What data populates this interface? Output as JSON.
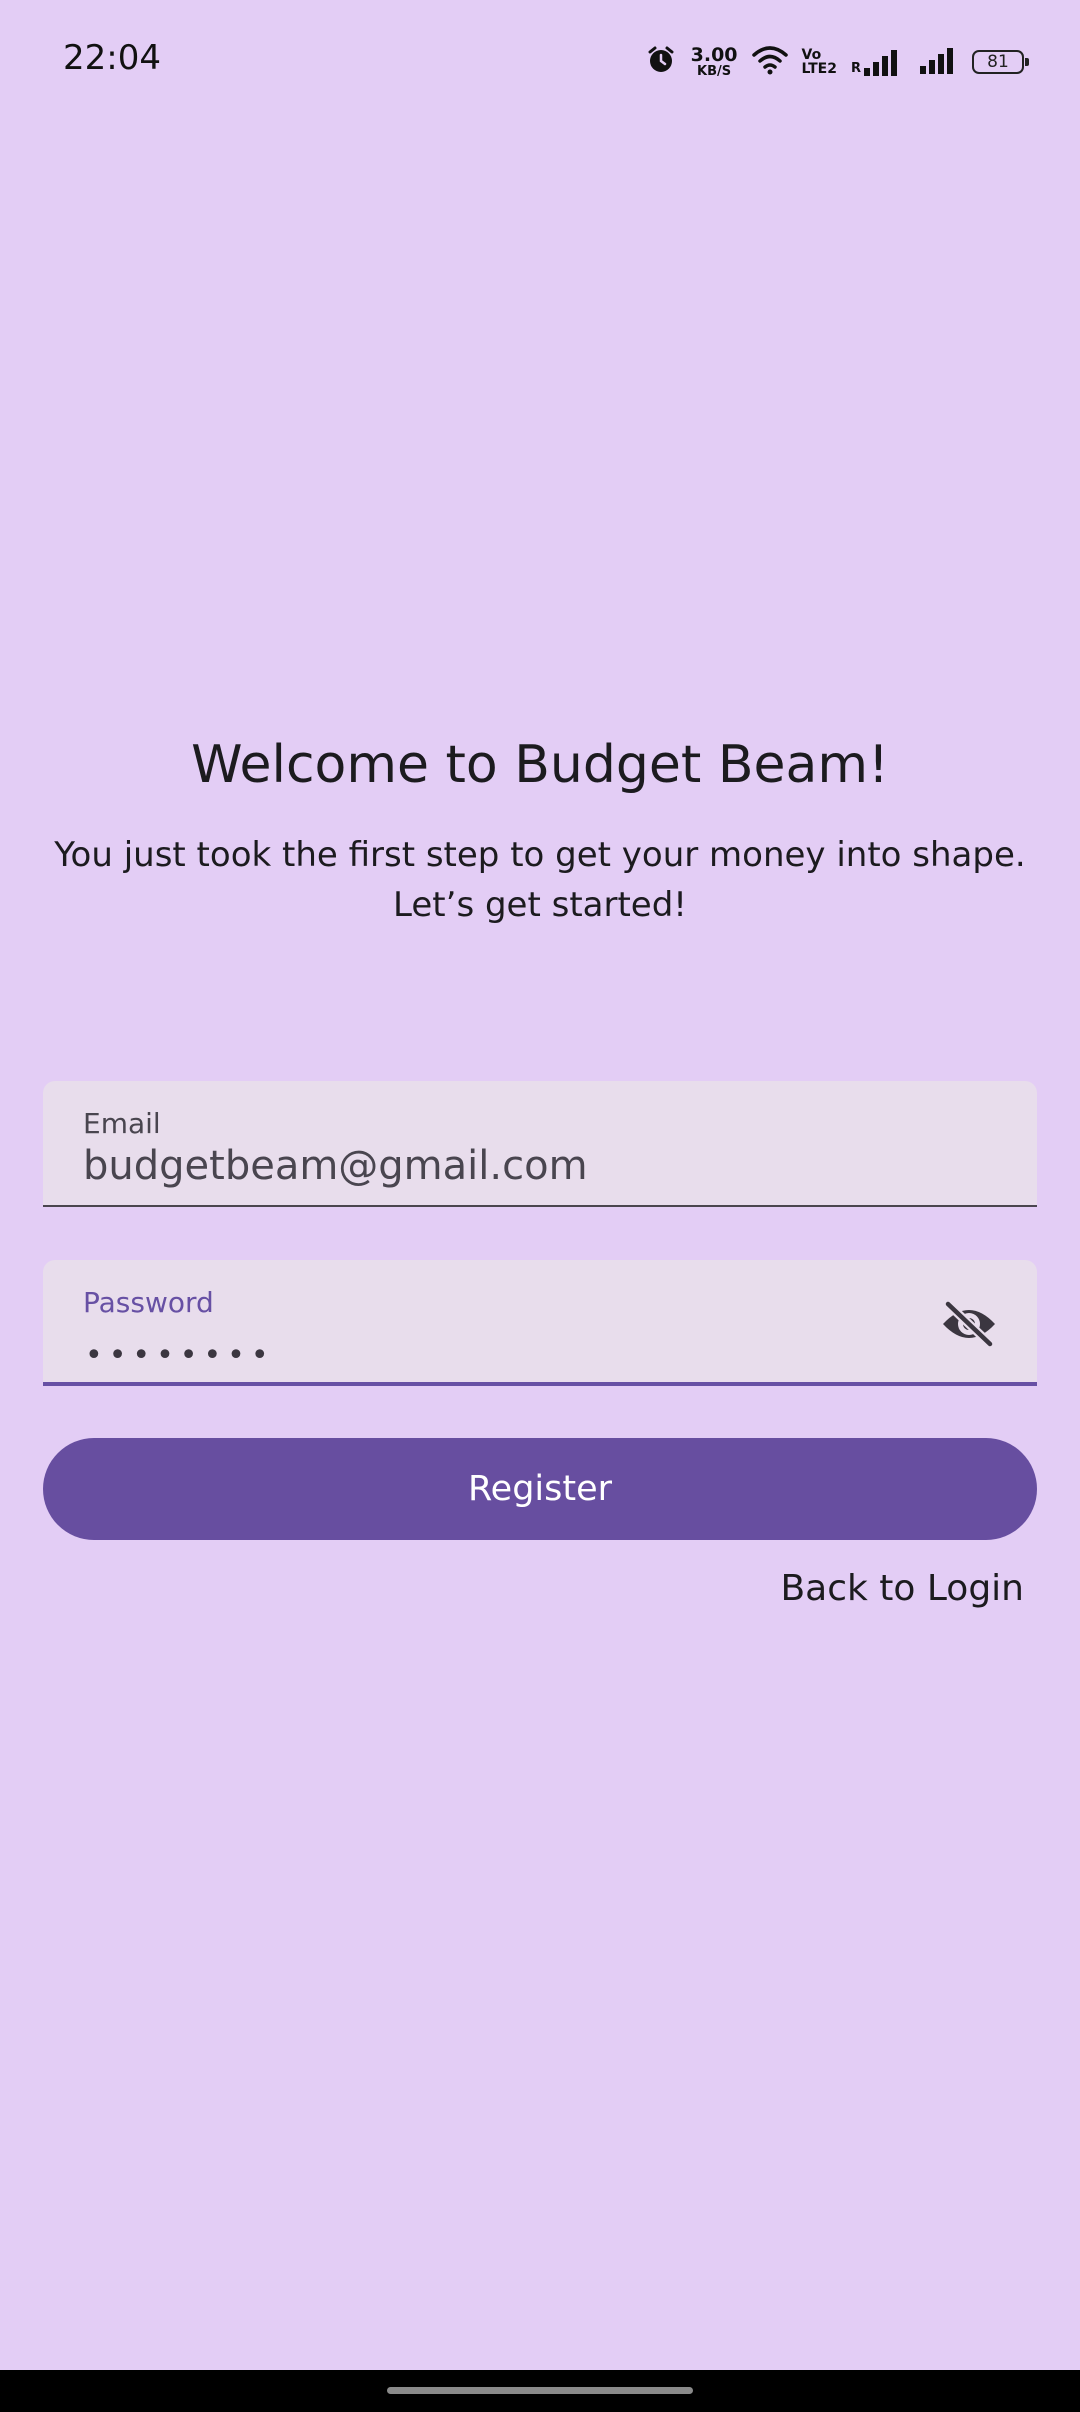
{
  "status_bar": {
    "time": "22:04",
    "net_speed_value": "3.00",
    "net_speed_unit": "KB/S",
    "volte_top": "Vo",
    "volte_bottom": "LTE2",
    "roaming": "R",
    "battery_level": "81",
    "icons": [
      "alarm-icon",
      "wifi-icon",
      "signal-icon",
      "signal-icon",
      "battery-icon"
    ]
  },
  "welcome": {
    "title": "Welcome to Budget Beam!",
    "subtitle_line1": "You just took the first step to get your money into shape.",
    "subtitle_line2": "Let’s get started!"
  },
  "form": {
    "email_label": "Email",
    "email_value": "budgetbeam@gmail.com",
    "password_label": "Password",
    "password_masked": "••••••••",
    "password_visibility_icon": "visibility-off-icon"
  },
  "actions": {
    "register_label": "Register",
    "back_to_login_label": "Back to Login"
  },
  "colors": {
    "background": "#e3cdf5",
    "field_background": "#e8ddec",
    "primary": "#674ea0",
    "on_primary": "#ffffff"
  }
}
